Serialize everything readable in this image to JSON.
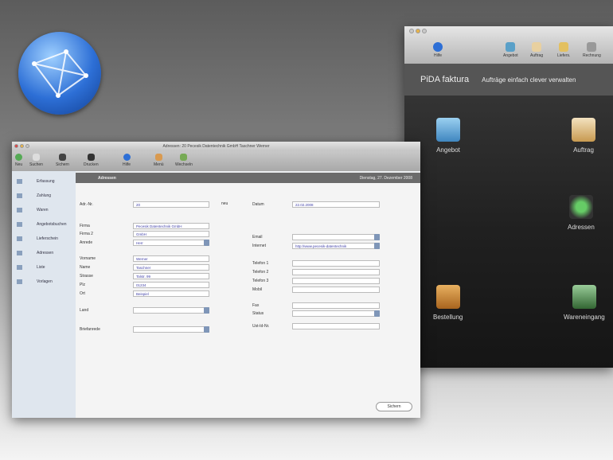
{
  "left_window": {
    "title": "Adressen: 20 Pecesik Datentechnik GmbH Taschner Werner",
    "toolbar": [
      "Neu",
      "Suchen",
      "Sichern",
      "Drucken",
      "Hilfe",
      "Menü",
      "Wechseln"
    ],
    "sidebar": [
      "Erfassung",
      "Zahlung",
      "Waren",
      "Angebotsbuchen",
      "Lieferschein",
      "Adressen",
      "Liste",
      "Vorlagen"
    ],
    "header": {
      "title": "Adressen",
      "date": "Dienstag, 27. Dezember 2008"
    },
    "form_left": [
      {
        "label": "Adr.-Nr.",
        "value": "20"
      },
      {
        "label": "Firma",
        "value": "Pecesik Datentechnik GmbH"
      },
      {
        "label": "Firma 2",
        "value": "GmbH"
      },
      {
        "label": "Anrede",
        "value": "Herr"
      },
      {
        "label": "Vorname",
        "value": "Werner"
      },
      {
        "label": "Name",
        "value": "Taschner"
      },
      {
        "label": "Strasse",
        "value": "Talstr. 99"
      },
      {
        "label": "Plz",
        "value": "01234"
      },
      {
        "label": "Ort",
        "value": "Beispiel"
      },
      {
        "label": "Land",
        "value": ""
      },
      {
        "label": "Briefanrede",
        "value": ""
      }
    ],
    "form_right": [
      {
        "label": "Datum",
        "value": "22.02.2008"
      },
      {
        "label": "Email",
        "value": ""
      },
      {
        "label": "Internet",
        "value": "http://www.pecesik-datentechnik"
      },
      {
        "label": "Telefon 1",
        "value": ""
      },
      {
        "label": "Telefon 2",
        "value": ""
      },
      {
        "label": "Telefon 3",
        "value": ""
      },
      {
        "label": "Mobil",
        "value": ""
      },
      {
        "label": "Fax",
        "value": ""
      },
      {
        "label": "Status",
        "value": ""
      },
      {
        "label": "Ust-Id-Nr.",
        "value": ""
      }
    ],
    "neu_label": "neu",
    "save_button": "Sichern"
  },
  "right_window": {
    "toolbar": [
      "Hilfe",
      "Angebot",
      "Auftrag",
      "Liefers.",
      "Rechnung"
    ],
    "app_name": "PiDA faktura",
    "tagline": "Aufträge einfach clever verwalten",
    "icons": [
      "Angebot",
      "Auftrag",
      "Adressen",
      "Bestellung",
      "Wareneingang"
    ]
  }
}
